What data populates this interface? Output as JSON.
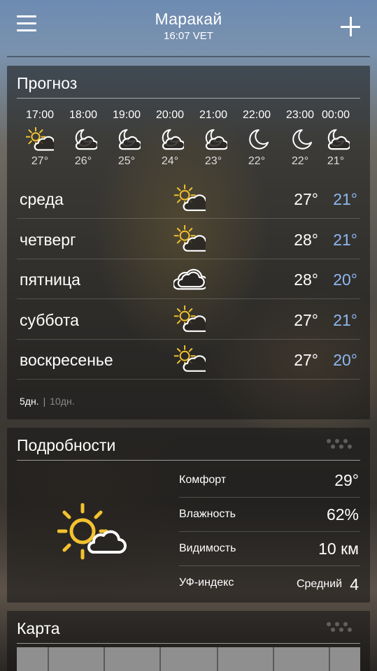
{
  "header": {
    "city": "Маракай",
    "time": "16:07 VET"
  },
  "forecast": {
    "title": "Прогноз",
    "hourly": [
      {
        "time": "17:00",
        "icon": "sun-cloud-icon",
        "temp": "27°"
      },
      {
        "time": "18:00",
        "icon": "moon-cloud-icon",
        "temp": "26°"
      },
      {
        "time": "19:00",
        "icon": "moon-cloud-icon",
        "temp": "25°"
      },
      {
        "time": "20:00",
        "icon": "moon-cloud-icon",
        "temp": "24°"
      },
      {
        "time": "21:00",
        "icon": "moon-cloud-icon",
        "temp": "23°"
      },
      {
        "time": "22:00",
        "icon": "moon-icon",
        "temp": "22°"
      },
      {
        "time": "23:00",
        "icon": "moon-icon",
        "temp": "22°"
      },
      {
        "time": "00:00",
        "icon": "moon-cloud-icon",
        "temp": "21°"
      }
    ],
    "daily": [
      {
        "day": "среда",
        "icon": "sun-cloud-icon",
        "high": "27°",
        "low": "21°"
      },
      {
        "day": "четверг",
        "icon": "sun-cloud-icon",
        "high": "28°",
        "low": "21°"
      },
      {
        "day": "пятница",
        "icon": "cloud-icon",
        "high": "28°",
        "low": "20°"
      },
      {
        "day": "суббота",
        "icon": "sun-cloud-icon",
        "high": "27°",
        "low": "21°"
      },
      {
        "day": "воскресенье",
        "icon": "sun-cloud-icon",
        "high": "27°",
        "low": "20°"
      }
    ],
    "range_5": "5дн.",
    "range_10": "10дн.",
    "low_color": "#8db8f0"
  },
  "details": {
    "title": "Подробности",
    "icon": "sun-cloud-icon",
    "rows": [
      {
        "label": "Комфорт",
        "value": "29°"
      },
      {
        "label": "Влажность",
        "value": "62%"
      },
      {
        "label": "Видимость",
        "value": "10 км"
      },
      {
        "label": "УФ-индекс",
        "value_text": "Средний",
        "value": "4"
      }
    ]
  },
  "map": {
    "title": "Карта"
  }
}
